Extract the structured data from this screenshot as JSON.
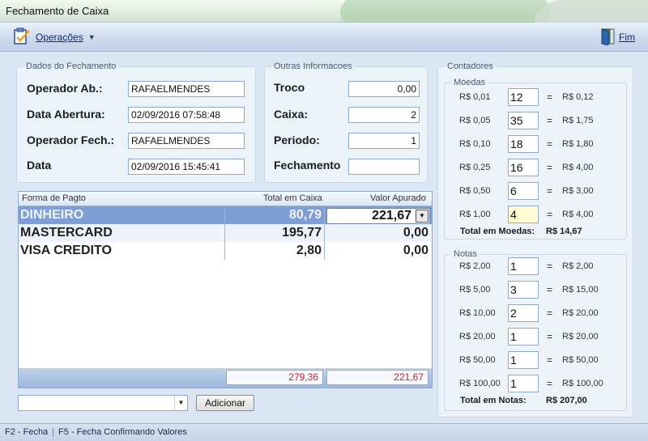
{
  "window": {
    "title": "Fechamento de Caixa"
  },
  "toolbar": {
    "operacoes": "Operações",
    "fim": "Fim"
  },
  "dados": {
    "legend": "Dados do Fechamento",
    "operador_ab_label": "Operador Ab.:",
    "operador_ab": "RAFAELMENDES",
    "data_abertura_label": "Data Abertura:",
    "data_abertura": "02/09/2016 07:58:48",
    "operador_fech_label": "Operador Fech.:",
    "operador_fech": "RAFAELMENDES",
    "data_label": "Data",
    "data": "02/09/2016 15:45:41"
  },
  "outras": {
    "legend": "Outras Informacoes",
    "troco_label": "Troco",
    "troco": "0,00",
    "caixa_label": "Caixa:",
    "caixa": "2",
    "periodo_label": "Periodo:",
    "periodo": "1",
    "fechamento_label": "Fechamento",
    "fechamento": ""
  },
  "grid": {
    "headers": [
      "Forma de Pagto",
      "Total em Caixa",
      "Valor Apurado"
    ],
    "rows": [
      {
        "forma": "DINHEIRO",
        "total": "80,79",
        "apurado": "221,67"
      },
      {
        "forma": "MASTERCARD",
        "total": "195,77",
        "apurado": "0,00"
      },
      {
        "forma": "VISA CREDITO",
        "total": "2,80",
        "apurado": "0,00"
      }
    ],
    "footer_total": "279,36",
    "footer_apurado": "221,67"
  },
  "adicionar": "Adicionar",
  "contadores": {
    "legend": "Contadores",
    "moedas_legend": "Moedas",
    "moedas": [
      {
        "denom": "R$ 0,01",
        "qty": "12",
        "total": "R$ 0,12"
      },
      {
        "denom": "R$ 0,05",
        "qty": "35",
        "total": "R$ 1,75"
      },
      {
        "denom": "R$ 0,10",
        "qty": "18",
        "total": "R$ 1,80"
      },
      {
        "denom": "R$ 0,25",
        "qty": "16",
        "total": "R$ 4,00"
      },
      {
        "denom": "R$ 0,50",
        "qty": "6",
        "total": "R$ 3,00"
      },
      {
        "denom": "R$ 1,00",
        "qty": "4",
        "total": "R$ 4,00"
      }
    ],
    "total_moedas_label": "Total em Moedas:",
    "total_moedas": "R$ 14,67",
    "notas_legend": "Notas",
    "notas": [
      {
        "denom": "R$ 2,00",
        "qty": "1",
        "total": "R$ 2,00"
      },
      {
        "denom": "R$ 5,00",
        "qty": "3",
        "total": "R$ 15,00"
      },
      {
        "denom": "R$ 10,00",
        "qty": "2",
        "total": "R$ 20,00"
      },
      {
        "denom": "R$ 20,00",
        "qty": "1",
        "total": "R$ 20,00"
      },
      {
        "denom": "R$ 50,00",
        "qty": "1",
        "total": "R$ 50,00"
      },
      {
        "denom": "R$ 100,00",
        "qty": "1",
        "total": "R$ 100,00"
      }
    ],
    "total_notas_label": "Total em Notas:",
    "total_notas": "R$ 207,00",
    "eq": "="
  },
  "status": {
    "f2": "F2 - Fecha",
    "sep": "|",
    "f5": "F5 - Fecha Confirmando Valores"
  }
}
